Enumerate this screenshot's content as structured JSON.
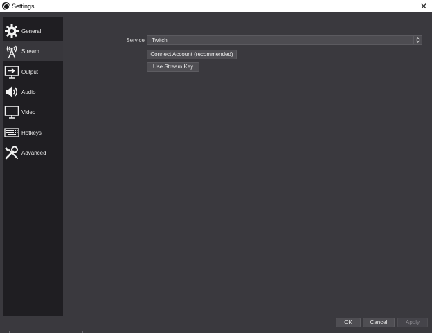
{
  "window": {
    "title": "Settings",
    "app_icon": "obs-logo-icon",
    "close_icon": "close-icon"
  },
  "sidebar": {
    "items": [
      {
        "label": "General",
        "icon": "gear-icon",
        "active": false
      },
      {
        "label": "Stream",
        "icon": "broadcast-tower-icon",
        "active": true
      },
      {
        "label": "Output",
        "icon": "output-display-icon",
        "active": false
      },
      {
        "label": "Audio",
        "icon": "speaker-icon",
        "active": false
      },
      {
        "label": "Video",
        "icon": "monitor-icon",
        "active": false
      },
      {
        "label": "Hotkeys",
        "icon": "keyboard-icon",
        "active": false
      },
      {
        "label": "Advanced",
        "icon": "tools-icon",
        "active": false
      }
    ]
  },
  "stream": {
    "service_label": "Service",
    "service_value": "Twitch",
    "connect_label": "Connect Account (recommended)",
    "stream_key_label": "Use Stream Key"
  },
  "footer": {
    "ok_label": "OK",
    "cancel_label": "Cancel",
    "apply_label": "Apply"
  },
  "colors": {
    "sidebar_bg": "#1f1e22",
    "panel_bg": "#3a393e",
    "active_item": "#38373c",
    "button": "#4f4e53"
  }
}
